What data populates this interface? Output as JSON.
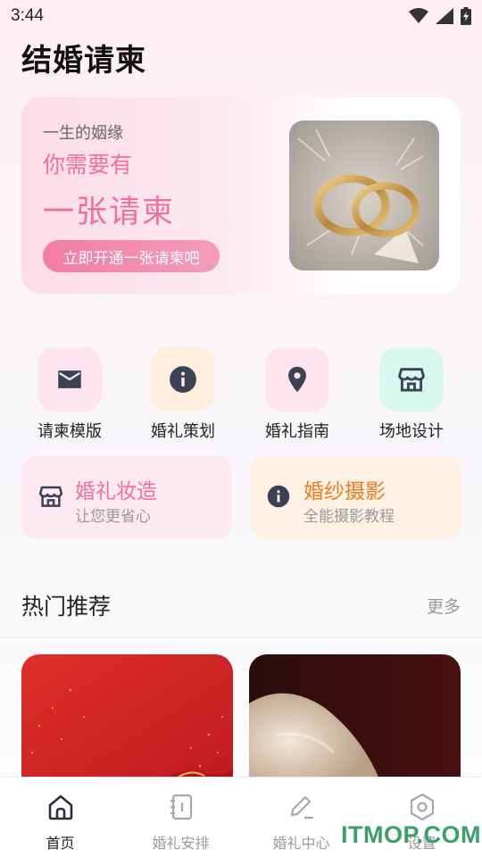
{
  "status_bar": {
    "time": "3:44"
  },
  "app_title": "结婚请柬",
  "banner": {
    "subtitle": "一生的姻缘",
    "line1": "你需要有",
    "line2": "一张请柬",
    "button_label": "立即开通一张请柬吧"
  },
  "quick_actions": [
    {
      "label": "请柬模版",
      "icon": "mail-icon",
      "bg": "#fde4ee"
    },
    {
      "label": "婚礼策划",
      "icon": "info-icon",
      "bg": "#fdeedd"
    },
    {
      "label": "婚礼指南",
      "icon": "location-pin-icon",
      "bg": "#fde4ee"
    },
    {
      "label": "场地设计",
      "icon": "store-icon",
      "bg": "#d7f7ef"
    }
  ],
  "feature_cards": [
    {
      "title": "婚礼妆造",
      "subtitle": "让您更省心",
      "icon": "store-icon",
      "bg": "#fce8f0",
      "title_color": "#f0709a"
    },
    {
      "title": "婚纱摄影",
      "subtitle": "全能摄影教程",
      "icon": "info-icon",
      "bg": "#fdf1e3",
      "title_color": "#f07a20"
    }
  ],
  "section": {
    "title": "热门推荐",
    "more_label": "更多"
  },
  "tab_bar": {
    "items": [
      {
        "label": "首页",
        "icon": "home-icon",
        "active": true
      },
      {
        "label": "婚礼安排",
        "icon": "notebook-icon",
        "active": false
      },
      {
        "label": "婚礼中心",
        "icon": "edit-icon",
        "active": false
      },
      {
        "label": "设置",
        "icon": "settings-hexagon-icon",
        "active": false
      }
    ]
  },
  "watermark": "ITMOP.COM",
  "colors": {
    "accent_pink": "#f0709a",
    "accent_orange": "#f07a20",
    "icon_dark": "#3b4254"
  }
}
